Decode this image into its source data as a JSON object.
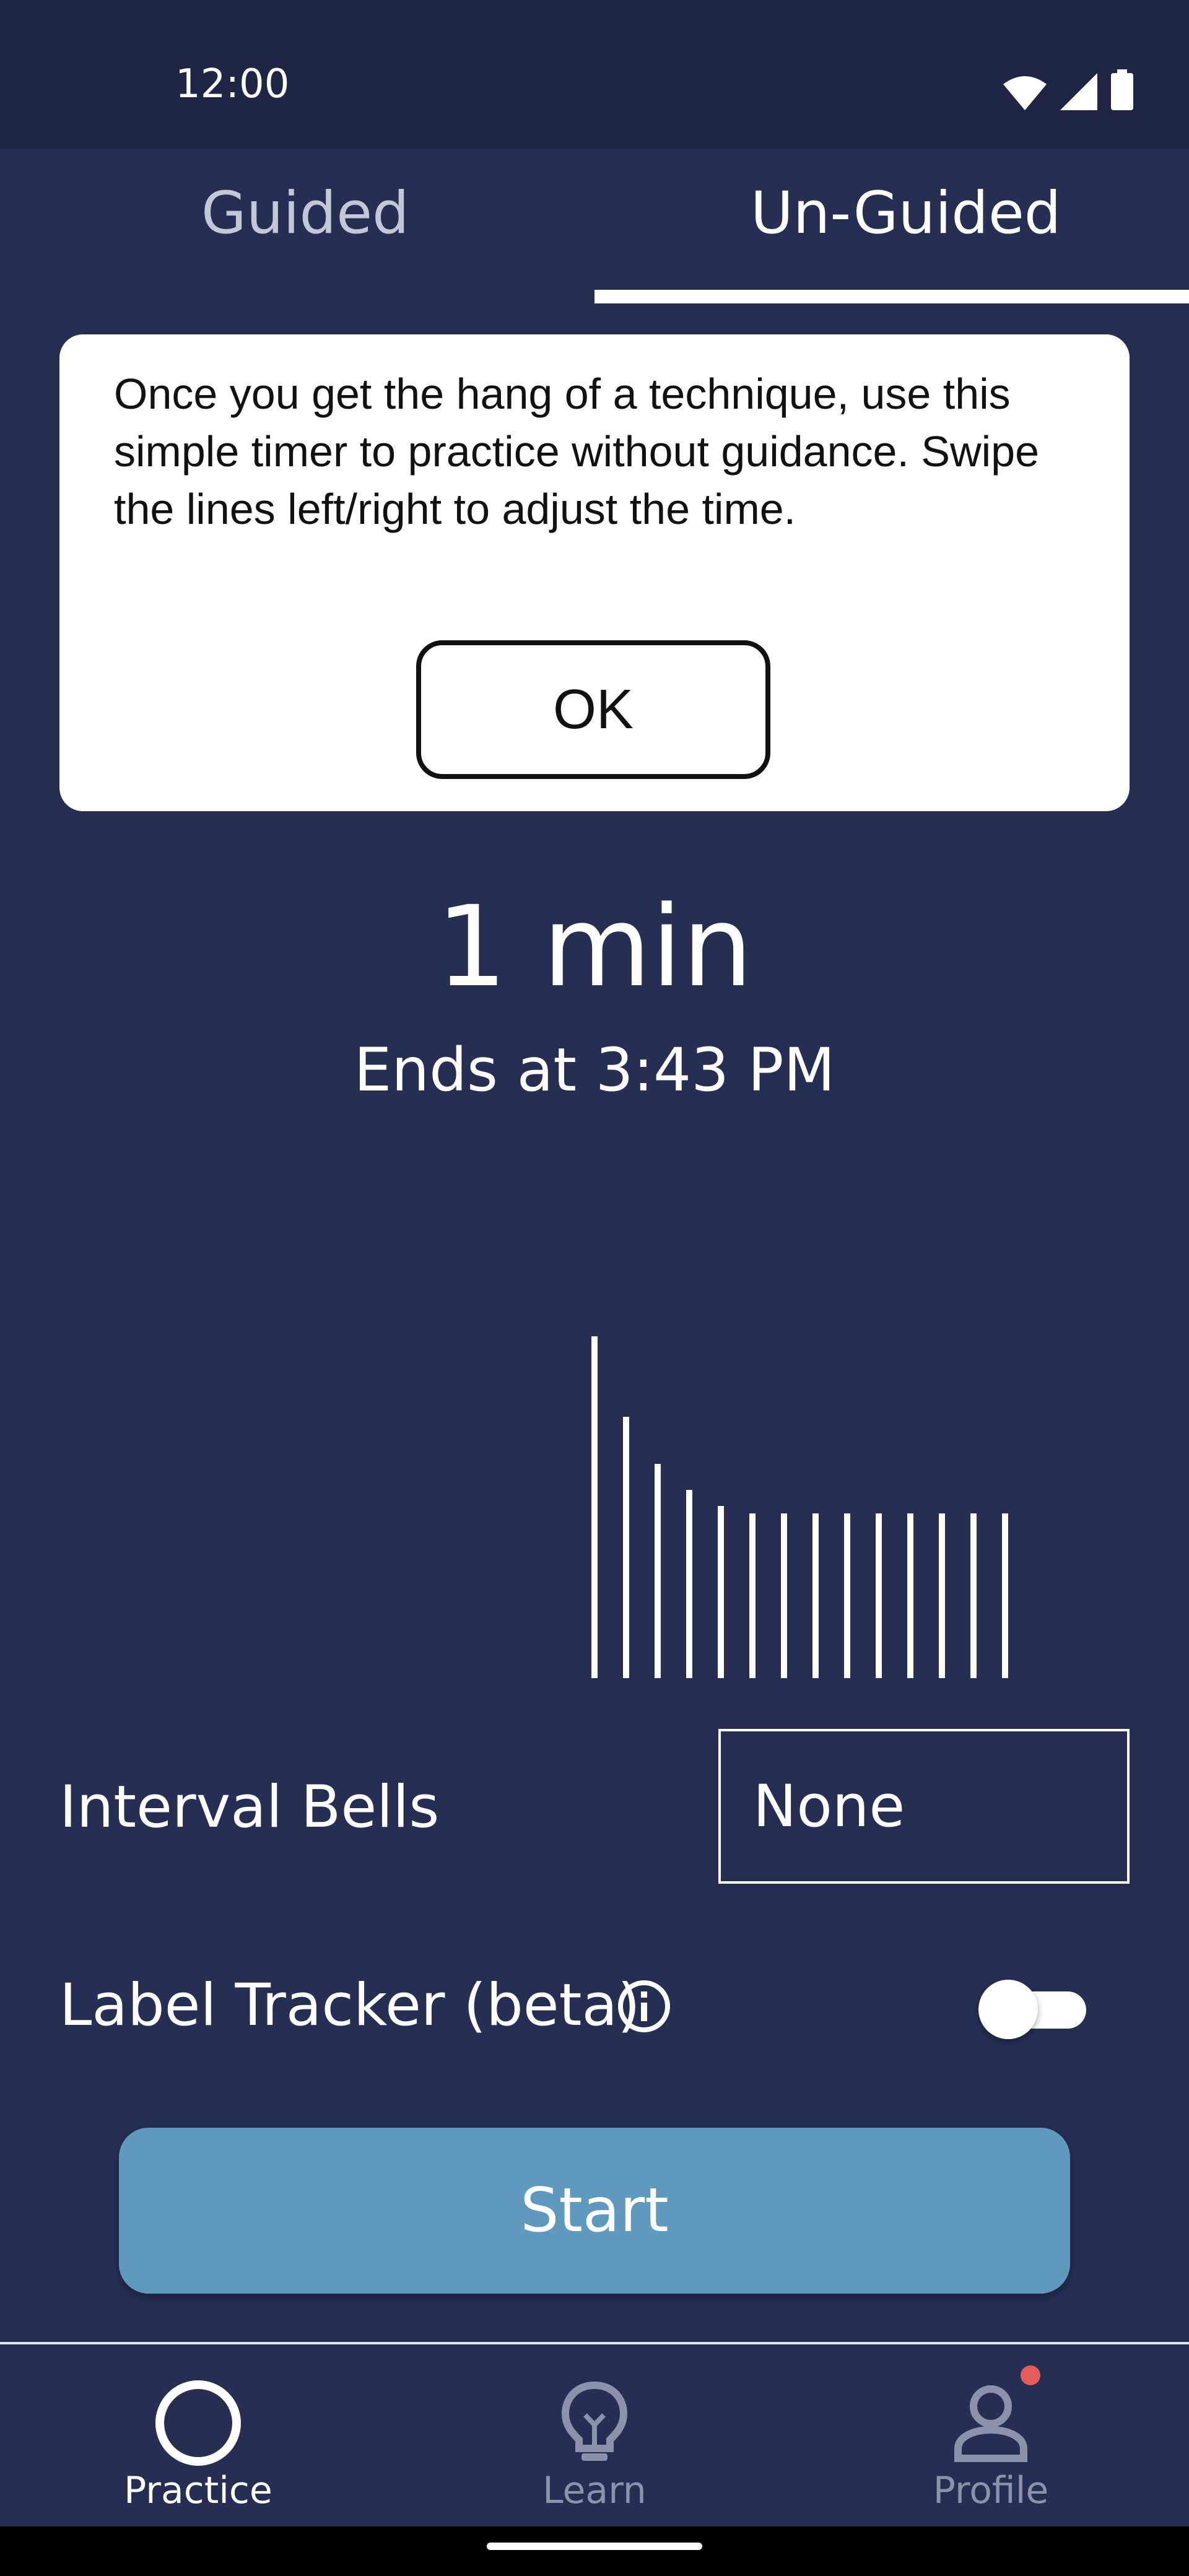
{
  "status_bar": {
    "time": "12:00",
    "icons": [
      "wifi-icon",
      "cellular-signal-icon",
      "battery-icon"
    ]
  },
  "tabs": {
    "items": [
      {
        "label": "Guided",
        "selected": false
      },
      {
        "label": "Un-Guided",
        "selected": true
      }
    ]
  },
  "dialog": {
    "message": "Once you get the hang of a technique, use this simple timer to practice without guidance. Swipe the lines left/right to adjust the time.",
    "ok_label": "OK"
  },
  "timer": {
    "duration": "1 min",
    "ends_at": "Ends at 3:43 PM"
  },
  "interval_bells": {
    "label": "Interval Bells",
    "selected": "None"
  },
  "label_tracker": {
    "label": "Label Tracker (beta)",
    "enabled": false
  },
  "start_label": "Start",
  "bottom_nav": {
    "items": [
      {
        "label": "Practice",
        "icon": "circle-icon",
        "active": true
      },
      {
        "label": "Learn",
        "icon": "lightbulb-icon",
        "active": false
      },
      {
        "label": "Profile",
        "icon": "person-icon",
        "active": false,
        "notification": true
      }
    ]
  },
  "colors": {
    "background": "#262f53",
    "status_bar": "#1f2645",
    "start_button": "#5f99bd",
    "notification_dot": "#e55b5b"
  }
}
